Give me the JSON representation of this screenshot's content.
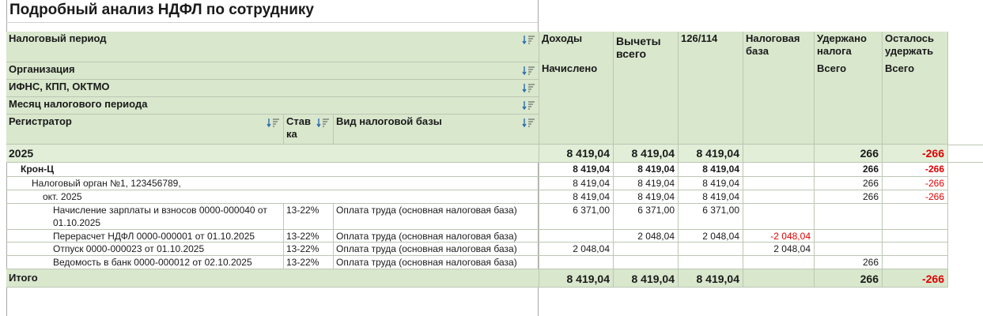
{
  "report": {
    "title": "Подробный анализ НДФЛ по сотруднику"
  },
  "columns": {
    "tax_period": "Налоговый период",
    "organization": "Организация",
    "ifns": "ИФНС, КПП, ОКТМО",
    "month": "Месяц налогового периода",
    "registrar": "Регистратор",
    "rate": "Ставка",
    "base_type": "Вид налоговой базы",
    "income": "Доходы",
    "income_sub": "Начислено",
    "deductions": "Вычеты всего",
    "code": "126/114",
    "tax_base": "Налоговая база",
    "withheld": "Удержано налога",
    "withheld_sub": "Всего",
    "remaining": "Осталось удержать",
    "remaining_sub": "Всего"
  },
  "rows": {
    "year": {
      "label": "2025",
      "income": "8 419,04",
      "deductions": "8 419,04",
      "code": "8 419,04",
      "withheld": "266",
      "remaining": "-266"
    },
    "org": {
      "label": "Крон-Ц",
      "income": "8 419,04",
      "deductions": "8 419,04",
      "code": "8 419,04",
      "withheld": "266",
      "remaining": "-266"
    },
    "ifns": {
      "label": "Налоговый орган №1, 123456789,",
      "income": "8 419,04",
      "deductions": "8 419,04",
      "code": "8 419,04",
      "withheld": "266",
      "remaining": "-266"
    },
    "month": {
      "label": "окт. 2025",
      "income": "8 419,04",
      "deductions": "8 419,04",
      "code": "8 419,04",
      "withheld": "266",
      "remaining": "-266"
    },
    "docs": [
      {
        "registrar": "Начисление зарплаты и взносов 0000-000040 от 01.10.2025",
        "rate": "13-22%",
        "base_type": "Оплата труда (основная налоговая база)",
        "income": "6 371,00",
        "deductions": "6 371,00",
        "code": "6 371,00",
        "tax_base": "",
        "withheld": ""
      },
      {
        "registrar": "Перерасчет НДФЛ 0000-000001 от 01.10.2025",
        "rate": "13-22%",
        "base_type": "Оплата труда (основная налоговая база)",
        "income": "",
        "deductions": "2 048,04",
        "code": "2 048,04",
        "tax_base": "-2 048,04",
        "withheld": ""
      },
      {
        "registrar": "Отпуск 0000-000023 от 01.10.2025",
        "rate": "13-22%",
        "base_type": "Оплата труда (основная налоговая база)",
        "income": "2 048,04",
        "deductions": "",
        "code": "",
        "tax_base": "2 048,04",
        "withheld": ""
      },
      {
        "registrar": "Ведомость в банк 0000-000012 от 02.10.2025",
        "rate": "13-22%",
        "base_type": "Оплата труда (основная налоговая база)",
        "income": "",
        "deductions": "",
        "code": "",
        "tax_base": "",
        "withheld": "266"
      }
    ],
    "total": {
      "label": "Итого",
      "income": "8 419,04",
      "deductions": "8 419,04",
      "code": "8 419,04",
      "withheld": "266",
      "remaining": "-266"
    }
  },
  "colors": {
    "header_bg": "#d9e7cd",
    "group_bg": "#e2eed8",
    "negative": "#e00000"
  }
}
